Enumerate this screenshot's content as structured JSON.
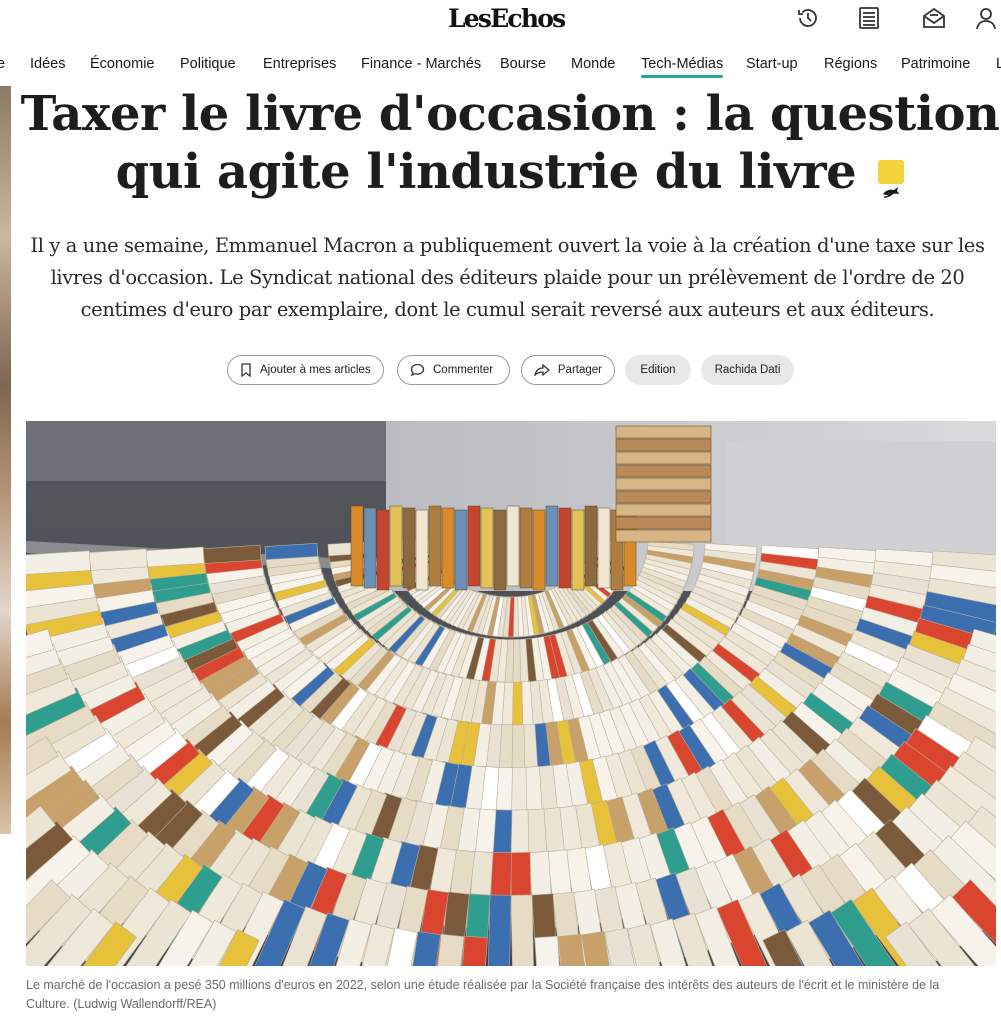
{
  "header": {
    "logo": "LesEchos",
    "icons": [
      "history-icon",
      "newspaper-icon",
      "newsletter-icon",
      "user-icon"
    ]
  },
  "nav": {
    "items": [
      {
        "label": "e"
      },
      {
        "label": "Idées"
      },
      {
        "label": "Économie"
      },
      {
        "label": "Politique"
      },
      {
        "label": "Entreprises"
      },
      {
        "label": "Finance - Marchés"
      },
      {
        "label": "Bourse"
      },
      {
        "label": "Monde"
      },
      {
        "label": "Tech-Médias"
      },
      {
        "label": "Start-up"
      },
      {
        "label": "Régions"
      },
      {
        "label": "Patrimoine"
      },
      {
        "label": "L"
      }
    ],
    "active": "Tech-Médias",
    "accent_color": "#1aa79d"
  },
  "article": {
    "title_line1": "Taxer le livre d'occasion : la question",
    "title_line2": "qui agite l'industrie du livre",
    "lead": "Il y a une semaine, Emmanuel Macron a publiquement ouvert la voie à la création d'une taxe sur les livres d'occasion. Le Syndicat national des éditeurs plaide pour un prélèvement de l'ordre de 20 centimes d'euro par exemplaire, dont le cumul serait reversé aux auteurs et aux éditeurs.",
    "actions": {
      "save": "Ajouter à mes articles",
      "comment": "Commenter",
      "share": "Partager"
    },
    "tags": [
      "Edition",
      "Rachida Dati"
    ],
    "caption": "Le marché de l'occasion a pesé 350 millions d'euros en 2022, selon une étude réalisée par la Société française des intérêts des auteurs de l'écrit et le ministère de la Culture. (Ludwig Wallendorff/REA)",
    "badge_color": "#f2d33c"
  }
}
